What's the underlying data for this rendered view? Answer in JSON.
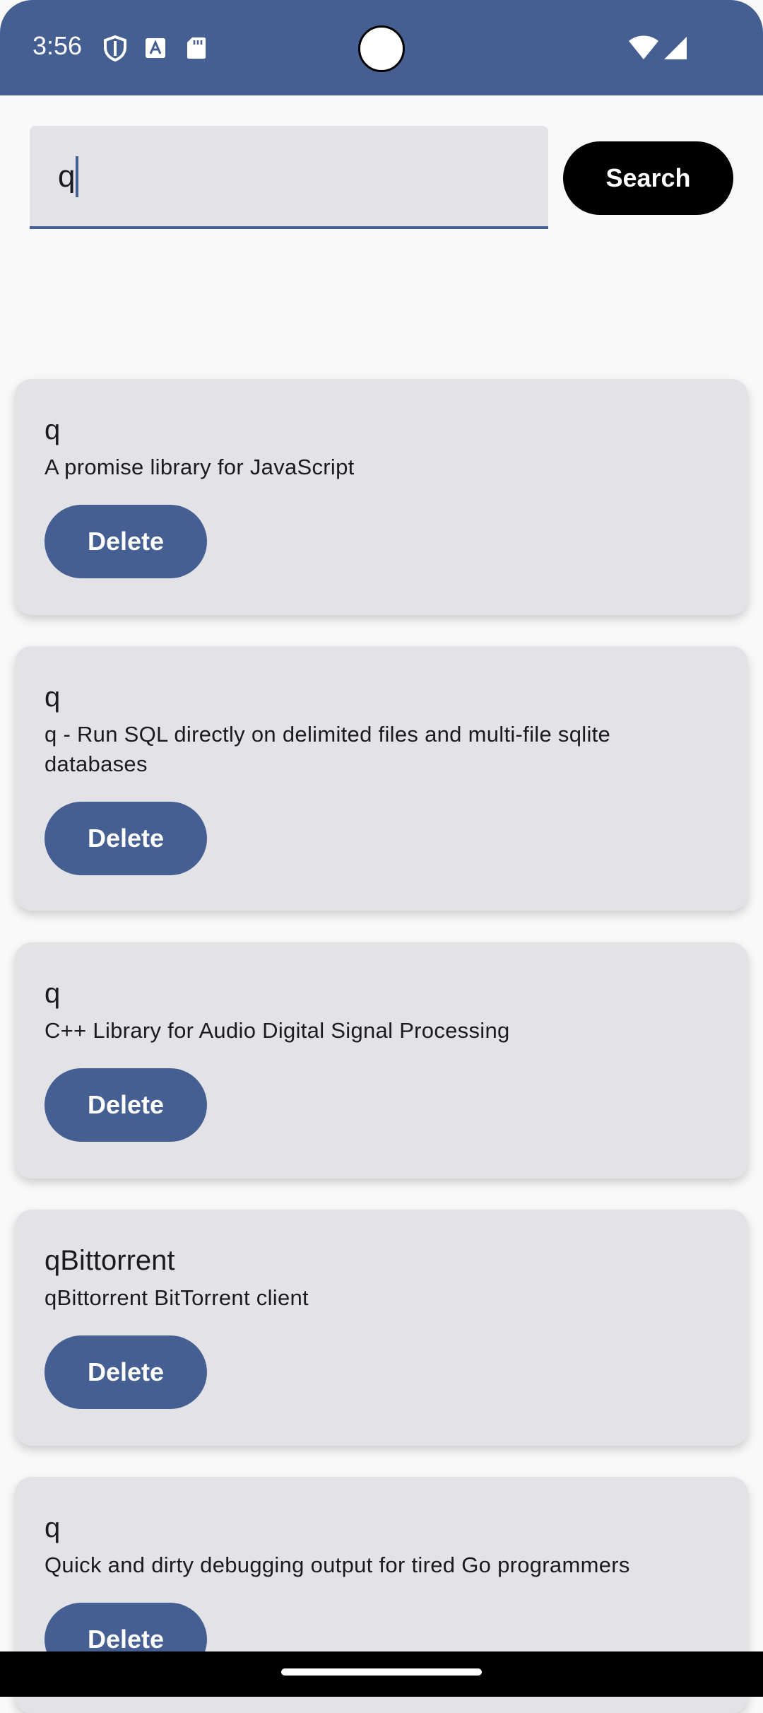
{
  "status_bar": {
    "time": "3:56",
    "icons": [
      "shield-icon",
      "text-a-icon",
      "sd-card-icon",
      "wifi-icon",
      "signal-icon"
    ],
    "color": "#465f93"
  },
  "search": {
    "value": "q",
    "button_label": "Search"
  },
  "results": [
    {
      "title": "q",
      "description": "A promise library for JavaScript",
      "delete_label": "Delete"
    },
    {
      "title": "q",
      "description": "q - Run SQL directly on delimited files and multi-file sqlite databases",
      "delete_label": "Delete"
    },
    {
      "title": "q",
      "description": "C++ Library for Audio Digital Signal Processing",
      "delete_label": "Delete"
    },
    {
      "title": "qBittorrent",
      "description": "qBittorrent BitTorrent client",
      "delete_label": "Delete"
    },
    {
      "title": "q",
      "description": "Quick and dirty debugging output for tired Go programmers",
      "delete_label": "Delete"
    }
  ],
  "colors": {
    "accent": "#465f93",
    "card_bg": "#e3e2e6",
    "page_bg": "#f9f9f9"
  }
}
